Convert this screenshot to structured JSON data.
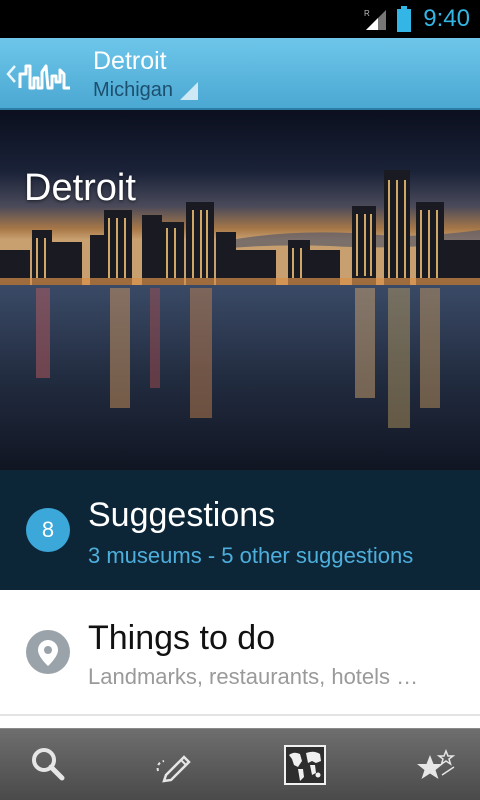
{
  "status_bar": {
    "time": "9:40",
    "signal_label": "R",
    "signal_icon": "signal-icon",
    "battery_icon": "battery-icon"
  },
  "action_bar": {
    "title": "Detroit",
    "subtitle": "Michigan",
    "back_icon": "chevron-left-icon",
    "logo_icon": "skyline-logo-icon",
    "dropdown_icon": "dropdown-triangle-icon"
  },
  "hero": {
    "title": "Detroit"
  },
  "suggestions": {
    "count": "8",
    "title": "Suggestions",
    "subtitle": "3 museums - 5 other suggestions"
  },
  "things_to_do": {
    "title": "Things to do",
    "subtitle": "Landmarks, restaurants, hotels …",
    "icon": "map-pin-icon"
  },
  "bottom_nav": [
    {
      "icon": "search-icon"
    },
    {
      "icon": "pencil-edit-icon"
    },
    {
      "icon": "world-map-icon"
    },
    {
      "icon": "stars-icon"
    }
  ],
  "colors": {
    "accent": "#33b5e5",
    "action_bar": "#5ab4dc",
    "suggestions_bg": "#0c2638",
    "badge": "#3ca8da",
    "subtitle_blue": "#4eaedc"
  }
}
